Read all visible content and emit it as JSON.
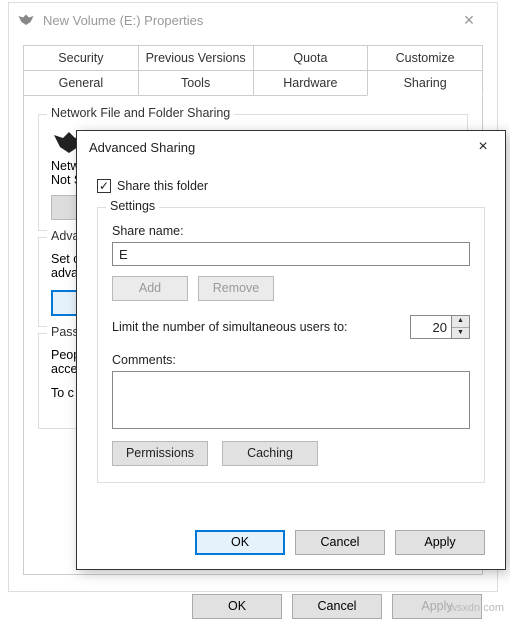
{
  "properties": {
    "title": "New Volume (E:) Properties",
    "tabs": {
      "row1": [
        "Security",
        "Previous Versions",
        "Quota",
        "Customize"
      ],
      "row2": [
        "General",
        "Tools",
        "Hardware",
        "Sharing"
      ]
    },
    "group1": {
      "legend": "Network File and Folder Sharing",
      "line1": "Netw",
      "line2": "Not S"
    },
    "group2": {
      "legend": "Adva",
      "line1": "Set c",
      "line2": "adva"
    },
    "group3": {
      "legend": "Pass",
      "line1": "Peop",
      "line2": "acce",
      "line3": "To c"
    },
    "buttons": {
      "ok": "OK",
      "cancel": "Cancel",
      "apply": "Apply"
    }
  },
  "advanced": {
    "title": "Advanced Sharing",
    "share_folder": "Share this folder",
    "settings_legend": "Settings",
    "share_name_label": "Share name:",
    "share_name_value": "E",
    "add": "Add",
    "remove": "Remove",
    "limit_label": "Limit the number of simultaneous users to:",
    "limit_value": "20",
    "comments_label": "Comments:",
    "permissions": "Permissions",
    "caching": "Caching",
    "ok": "OK",
    "cancel": "Cancel",
    "apply": "Apply"
  },
  "watermark": "wsxdn.com"
}
